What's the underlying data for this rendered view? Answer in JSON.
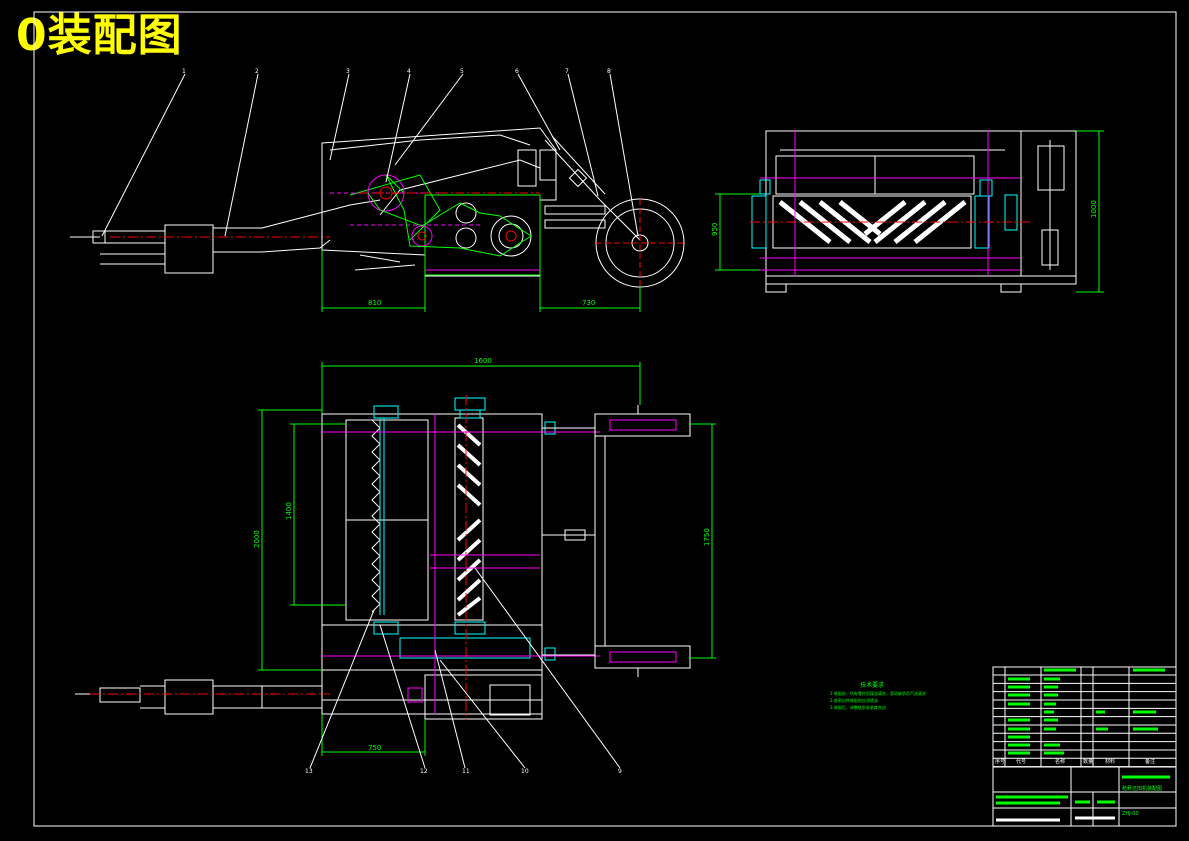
{
  "title": "0装配图",
  "colors": {
    "background": "#000000",
    "outline": "#ffffff",
    "dimension": "#00ff00",
    "centerline": "#ff0000",
    "hidden": "#ff00ff",
    "parts": "#00ffff",
    "title_text": "#ffff00"
  },
  "balloons": {
    "top": [
      "1",
      "2",
      "3",
      "4",
      "5",
      "6",
      "7",
      "8"
    ],
    "bottom": [
      "13",
      "12",
      "11",
      "10",
      "9"
    ]
  },
  "dimensions": {
    "front_left": "810",
    "front_right": "730",
    "side_height_left": "950",
    "side_height_right": "1000",
    "plan_top": "1600",
    "plan_left_outer": "2000",
    "plan_left_inner": "1400",
    "plan_right": "1750",
    "plan_bottom": "750"
  },
  "tech_notes": {
    "heading": "技术要求",
    "lines": [
      "1.装配前，所有零件用煤油清洗，滚动轴承用汽油清洗",
      "2.各密封件装配前应浸透油",
      "3.装配后，调整链条张紧度合适"
    ]
  },
  "title_block": {
    "headers": [
      "序号",
      "代号",
      "名称",
      "数量",
      "材料",
      "备注"
    ],
    "project": "秸秆还田机装配图",
    "drawing_no": "ZHJ-00"
  }
}
